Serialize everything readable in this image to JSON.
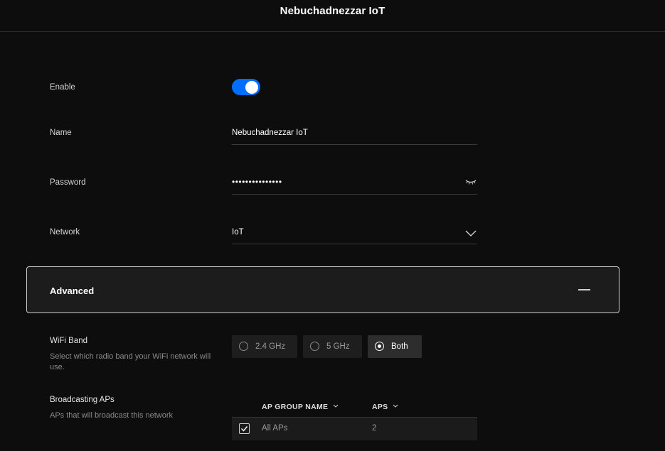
{
  "header": {
    "title": "Nebuchadnezzar IoT"
  },
  "form": {
    "enable_label": "Enable",
    "enable_on": true,
    "name_label": "Name",
    "name_value": "Nebuchadnezzar IoT",
    "password_label": "Password",
    "password_masked": "•••••••••••••••",
    "network_label": "Network",
    "network_value": "IoT"
  },
  "advanced": {
    "title": "Advanced",
    "expanded": true,
    "wifi_band": {
      "title": "WiFi Band",
      "description": "Select which radio band your WiFi network will use.",
      "options": [
        "2.4 GHz",
        "5 GHz",
        "Both"
      ],
      "selected": "Both"
    },
    "broadcasting_aps": {
      "title": "Broadcasting APs",
      "description": "APs that will broadcast this network",
      "columns": [
        "AP GROUP NAME",
        "APS"
      ],
      "rows": [
        {
          "name": "All APs",
          "aps": "2",
          "checked": true
        }
      ]
    }
  },
  "icons": {
    "password_toggle": "eye-closed-icon",
    "network_dropdown": "chevron-down-icon",
    "advanced_collapse": "minus-icon"
  },
  "colors": {
    "accent": "#006fff",
    "background": "#0d0d0d",
    "panel": "#1c1c1c"
  }
}
